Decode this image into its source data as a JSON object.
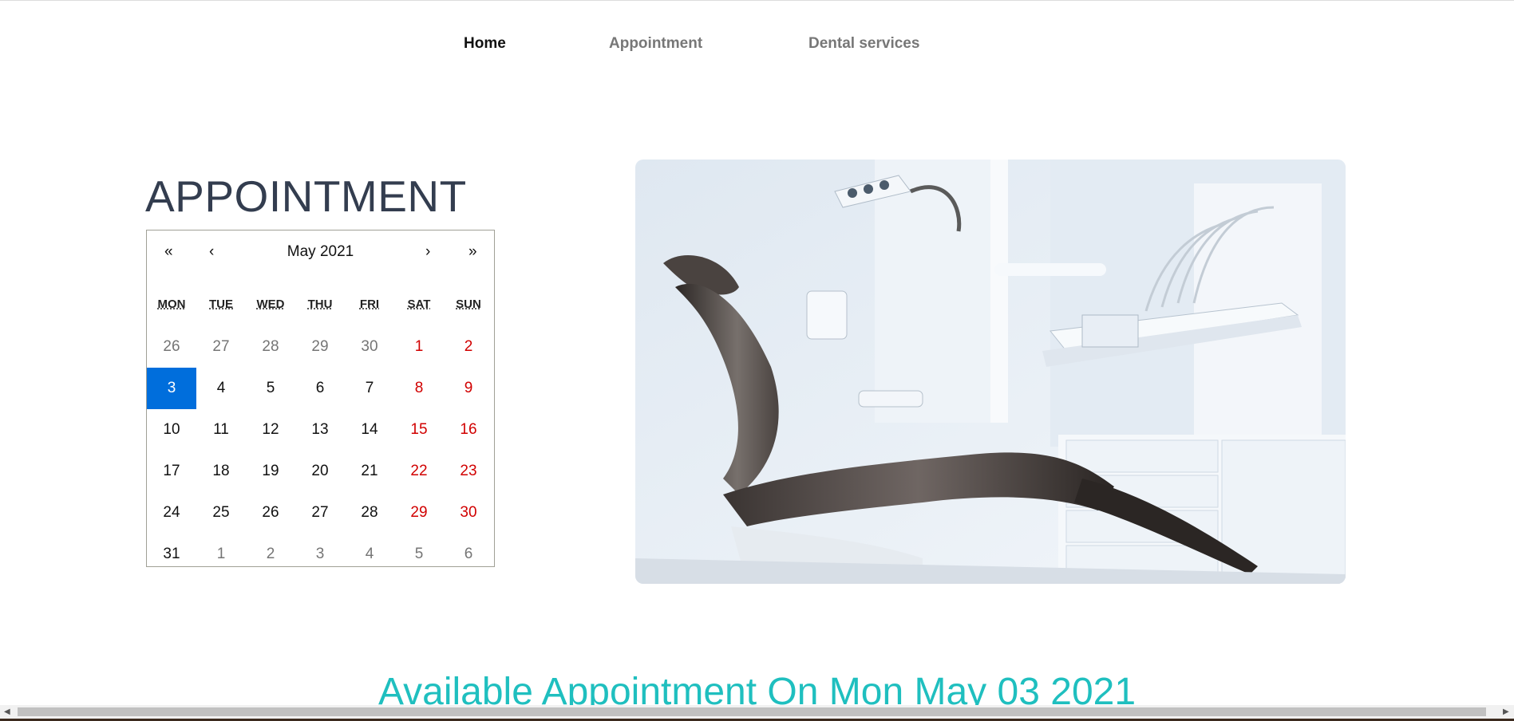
{
  "nav": {
    "home": "Home",
    "appointment": "Appointment",
    "dental_services": "Dental services"
  },
  "heading": "APPOINTMENT",
  "calendar": {
    "prev2": "«",
    "prev": "‹",
    "label": "May 2021",
    "next": "›",
    "next2": "»",
    "weekdays": [
      "MON",
      "TUE",
      "WED",
      "THU",
      "FRI",
      "SAT",
      "SUN"
    ],
    "weeks": [
      [
        "26",
        "27",
        "28",
        "29",
        "30",
        "1",
        "2"
      ],
      [
        "3",
        "4",
        "5",
        "6",
        "7",
        "8",
        "9"
      ],
      [
        "10",
        "11",
        "12",
        "13",
        "14",
        "15",
        "16"
      ],
      [
        "17",
        "18",
        "19",
        "20",
        "21",
        "22",
        "23"
      ],
      [
        "24",
        "25",
        "26",
        "27",
        "28",
        "29",
        "30"
      ],
      [
        "31",
        "1",
        "2",
        "3",
        "4",
        "5",
        "6"
      ]
    ],
    "selected": "3"
  },
  "image_alt": "dental chair in clinic",
  "available_title": "Available Appointment On Mon May 03 2021",
  "colors": {
    "heading": "#333d4f",
    "accent": "#1fbfbf",
    "selected": "#006edc",
    "weekend": "#d10000"
  }
}
